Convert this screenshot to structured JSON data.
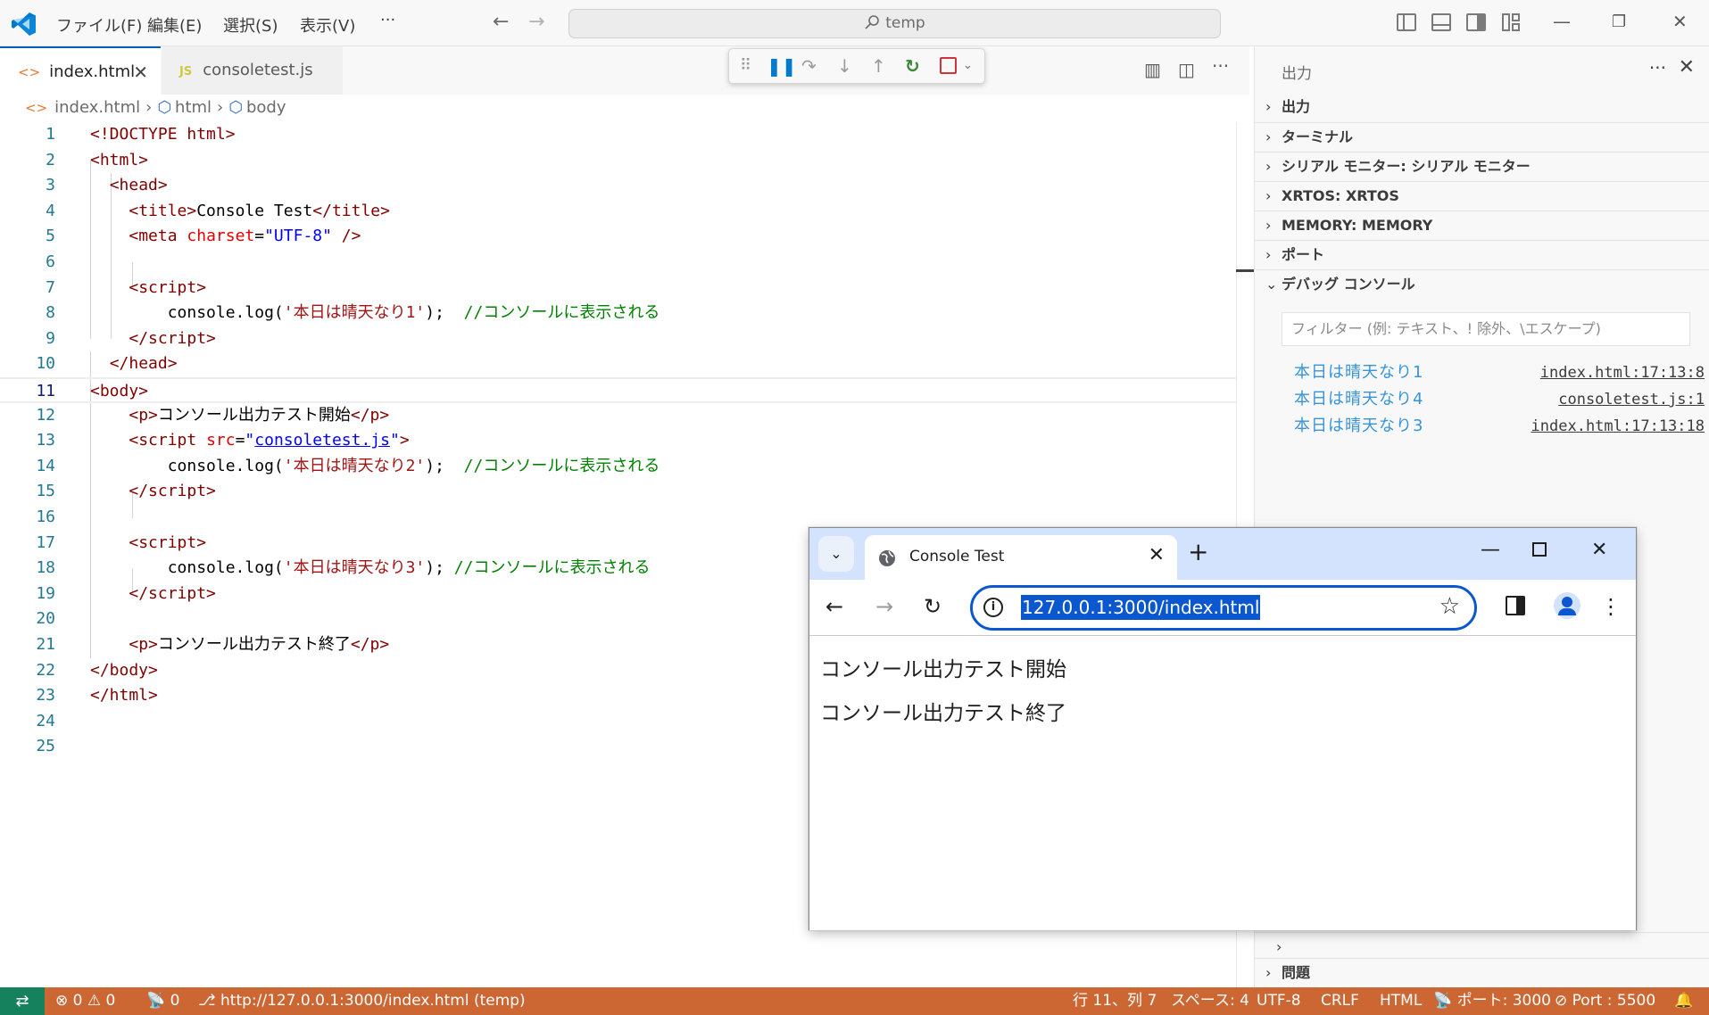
{
  "titlebar": {
    "menus": [
      "ファイル(F)",
      "編集(E)",
      "選択(S)",
      "表示(V)",
      "···"
    ],
    "search": "temp"
  },
  "tabs": [
    {
      "label": "index.html",
      "icon": "html-file-icon",
      "active": true
    },
    {
      "label": "consoletest.js",
      "icon_text": "JS",
      "active": false
    }
  ],
  "breadcrumb": [
    "index.html",
    "html",
    "body"
  ],
  "code": {
    "line_numbers": [
      "1",
      "2",
      "3",
      "4",
      "5",
      "6",
      "7",
      "8",
      "9",
      "10",
      "11",
      "12",
      "13",
      "14",
      "15",
      "16",
      "17",
      "18",
      "19",
      "20",
      "21",
      "22",
      "23",
      "24",
      "25"
    ],
    "active_line": 11
  },
  "output_panel": {
    "header": "出力",
    "sections": [
      "出力",
      "ターミナル",
      "シリアル モニター: シリアル モニター",
      "XRTOS: XRTOS",
      "MEMORY: MEMORY",
      "ポート",
      "デバッグ コンソール"
    ],
    "filter_placeholder": "フィルター (例: テキスト、! 除外、\\エスケープ)",
    "console": [
      {
        "message": "本日は晴天なり1",
        "source": "index.html:17:13:8"
      },
      {
        "message": "本日は晴天なり4",
        "source": "consoletest.js:1"
      },
      {
        "message": "本日は晴天なり3",
        "source": "index.html:17:13:18"
      }
    ],
    "bottom_section": "問題"
  },
  "statusbar": {
    "errors": "0",
    "warnings": "0",
    "ports_count": "0",
    "live_url": "http://127.0.0.1:3000/index.html (temp)",
    "position": "行 11、列 7",
    "spaces": "スペース: 4",
    "encoding": "UTF-8",
    "eol": "CRLF",
    "language": "HTML",
    "port": "ポート: 3000",
    "live_port": "Port : 5500"
  },
  "browser": {
    "tab_title": "Console Test",
    "url": "127.0.0.1:3000/index.html",
    "paragraphs": [
      "コンソール出力テスト開始",
      "コンソール出力テスト終了"
    ]
  },
  "colors": {
    "statusbar": "#cc6633",
    "remote": "#16825d",
    "accent": "#005fb8",
    "console_text": "#3794d8",
    "omnibox": "#0b57d0"
  }
}
